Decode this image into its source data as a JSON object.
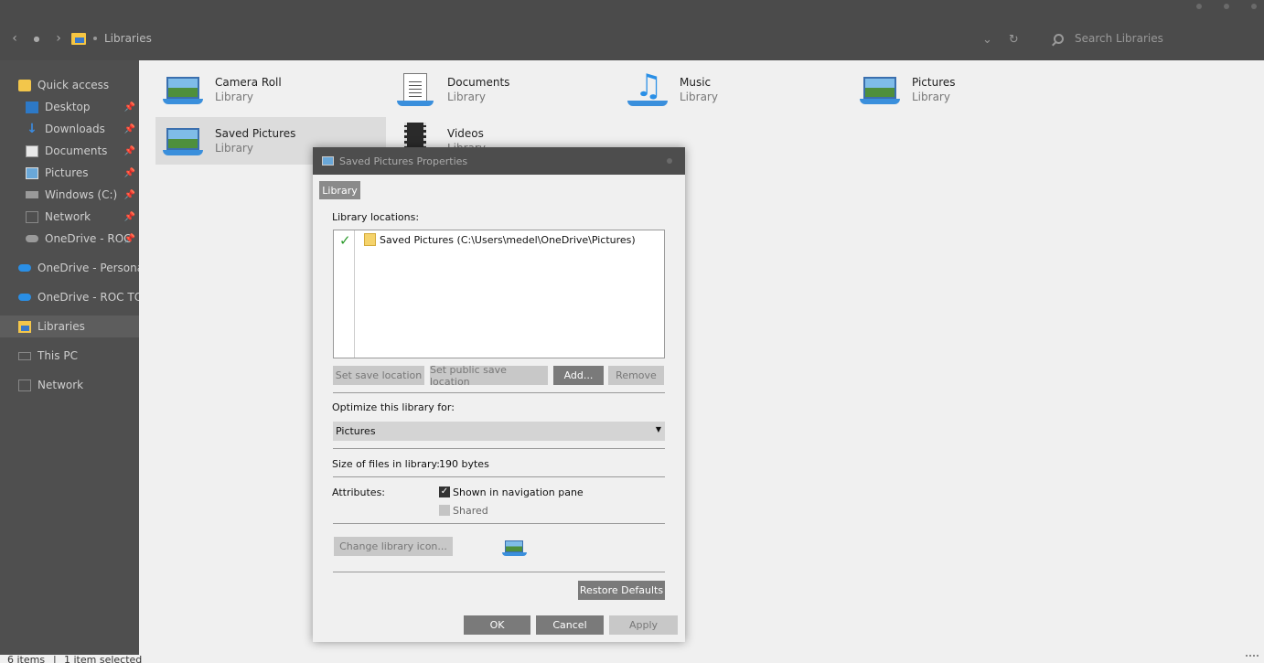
{
  "window": {
    "controls": [
      "minimize",
      "maximize",
      "close"
    ]
  },
  "address": {
    "location": "Libraries",
    "search_placeholder": "Search Libraries"
  },
  "sidebar": {
    "items": [
      {
        "label": "Quick access",
        "icon": "star-folder-icon"
      },
      {
        "label": "Desktop",
        "icon": "desktop-icon",
        "pinned": true
      },
      {
        "label": "Downloads",
        "icon": "download-icon",
        "pinned": true
      },
      {
        "label": "Documents",
        "icon": "document-icon",
        "pinned": true
      },
      {
        "label": "Pictures",
        "icon": "picture-icon",
        "pinned": true
      },
      {
        "label": "Windows (C:)",
        "icon": "drive-icon",
        "pinned": true
      },
      {
        "label": "Network",
        "icon": "network-icon",
        "pinned": true
      },
      {
        "label": "OneDrive - ROC",
        "icon": "cloud-icon",
        "pinned": true
      },
      {
        "label": "OneDrive - Personal",
        "icon": "onedrive-icon"
      },
      {
        "label": "OneDrive - ROC TOP",
        "icon": "onedrive-icon"
      },
      {
        "label": "Libraries",
        "icon": "libraries-icon",
        "selected": true
      },
      {
        "label": "This PC",
        "icon": "pc-icon"
      },
      {
        "label": "Network",
        "icon": "network-icon"
      }
    ]
  },
  "libraries": [
    {
      "name": "Camera Roll",
      "type": "Library",
      "icon": "picture-library-icon"
    },
    {
      "name": "Documents",
      "type": "Library",
      "icon": "documents-library-icon"
    },
    {
      "name": "Music",
      "type": "Library",
      "icon": "music-library-icon"
    },
    {
      "name": "Pictures",
      "type": "Library",
      "icon": "picture-library-icon"
    },
    {
      "name": "Saved Pictures",
      "type": "Library",
      "icon": "picture-library-icon",
      "selected": true
    },
    {
      "name": "Videos",
      "type": "Library",
      "icon": "video-library-icon"
    }
  ],
  "status": {
    "items": "6 items",
    "selected": "1 item selected"
  },
  "dialog": {
    "title": "Saved Pictures Properties",
    "tab": "Library",
    "locations_label": "Library locations:",
    "location": "Saved Pictures (C:\\Users\\medel\\OneDrive\\Pictures)",
    "set_save": "Set save location",
    "set_public_save": "Set public save location",
    "add": "Add...",
    "remove": "Remove",
    "optimize_label": "Optimize this library for:",
    "optimize_value": "Pictures",
    "size_label": "Size of files in library:",
    "size_value": "190 bytes",
    "attributes_label": "Attributes:",
    "shown_in_nav": "Shown in navigation pane",
    "shown_in_nav_checked": true,
    "shared": "Shared",
    "shared_checked": false,
    "change_icon": "Change library icon...",
    "restore": "Restore Defaults",
    "ok": "OK",
    "cancel": "Cancel",
    "apply": "Apply"
  }
}
